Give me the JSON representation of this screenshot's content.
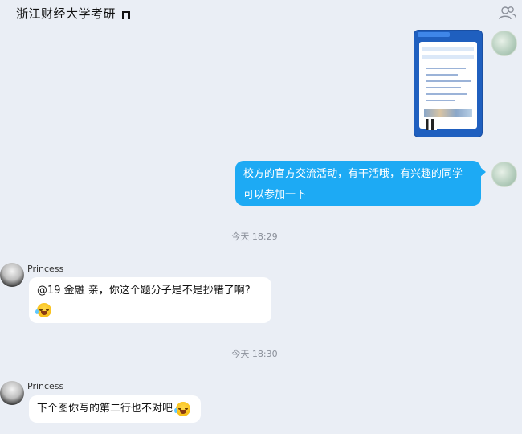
{
  "header": {
    "title": "浙江财经大学考研",
    "group_icon": "group-members-icon"
  },
  "messages": [
    {
      "type": "image",
      "from": "self"
    },
    {
      "type": "text",
      "from": "self",
      "lines": [
        "校方的官方交流活动，有干活哦，有兴趣的同学",
        "可以参加一下"
      ]
    },
    {
      "type": "time",
      "text": "今天 18:29"
    },
    {
      "type": "text",
      "from": "Princess",
      "sender": "Princess",
      "lines": [
        "@19 金融 亲，你这个题分子是不是抄错了啊?"
      ],
      "emoji": "laugh-cry-emoji"
    },
    {
      "type": "time",
      "text": "今天 18:30"
    },
    {
      "type": "text",
      "from": "Princess",
      "sender": "Princess",
      "lines": [
        "下个图你写的第二行也不对吧"
      ],
      "emoji": "laugh-cry-emoji"
    }
  ],
  "colors": {
    "background": "#eaeef5",
    "self_bubble": "#1daaf4",
    "other_bubble": "#ffffff"
  }
}
